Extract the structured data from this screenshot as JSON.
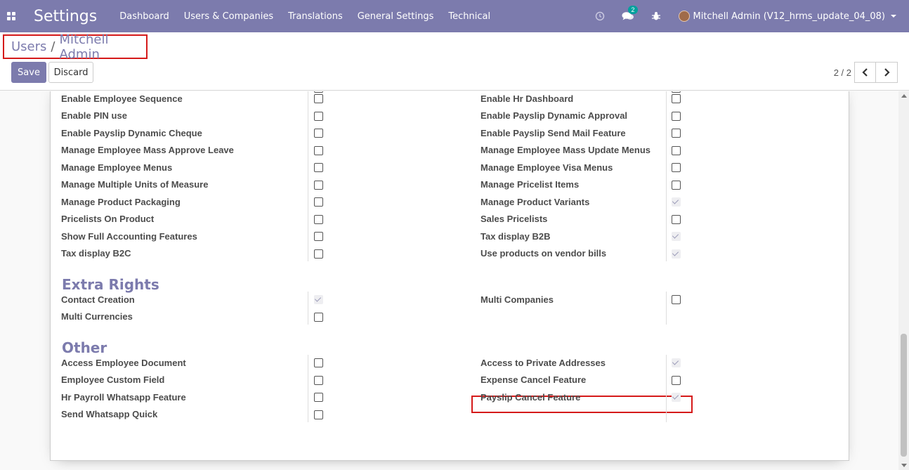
{
  "navbar": {
    "title": "Settings",
    "menu": [
      "Dashboard",
      "Users & Companies",
      "Translations",
      "General Settings",
      "Technical"
    ],
    "chat_count": "2",
    "user_label": "Mitchell Admin (V12_hrms_update_04_08)"
  },
  "breadcrumb": {
    "parent": "Users",
    "separator": "/",
    "current": "Mitchell Admin"
  },
  "buttons": {
    "save": "Save",
    "discard": "Discard"
  },
  "pager": {
    "value": "2 / 2"
  },
  "left_rows": [
    {
      "label": "Enable Employee Sequence",
      "checked": false
    },
    {
      "label": "Enable PIN use",
      "checked": false
    },
    {
      "label": "Enable Payslip Dynamic Cheque",
      "checked": false
    },
    {
      "label": "Manage Employee Mass Approve Leave",
      "checked": false
    },
    {
      "label": "Manage Employee Menus",
      "checked": false
    },
    {
      "label": "Manage Multiple Units of Measure",
      "checked": false
    },
    {
      "label": "Manage Product Packaging",
      "checked": false
    },
    {
      "label": "Pricelists On Product",
      "checked": false
    },
    {
      "label": "Show Full Accounting Features",
      "checked": false
    },
    {
      "label": "Tax display B2C",
      "checked": false
    }
  ],
  "right_rows": [
    {
      "label": "Enable Hr Dashboard",
      "checked": false
    },
    {
      "label": "Enable Payslip Dynamic Approval",
      "checked": false
    },
    {
      "label": "Enable Payslip Send Mail Feature",
      "checked": false
    },
    {
      "label": "Manage Employee Mass Update Menus",
      "checked": false
    },
    {
      "label": "Manage Employee Visa Menus",
      "checked": false
    },
    {
      "label": "Manage Pricelist Items",
      "checked": false
    },
    {
      "label": "Manage Product Variants",
      "checked": true
    },
    {
      "label": "Sales Pricelists",
      "checked": false
    },
    {
      "label": "Tax display B2B",
      "checked": true
    },
    {
      "label": "Use products on vendor bills",
      "checked": true
    }
  ],
  "extra_rights": {
    "title": "Extra Rights",
    "left": [
      {
        "label": "Contact Creation",
        "checked": true
      },
      {
        "label": "Multi Currencies",
        "checked": false
      }
    ],
    "right": [
      {
        "label": "Multi Companies",
        "checked": false
      }
    ]
  },
  "other": {
    "title": "Other",
    "left": [
      {
        "label": "Access Employee Document",
        "checked": false
      },
      {
        "label": "Employee Custom Field",
        "checked": false
      },
      {
        "label": "Hr Payroll Whatsapp Feature",
        "checked": false
      },
      {
        "label": "Send Whatsapp Quick",
        "checked": false
      }
    ],
    "right": [
      {
        "label": "Access to Private Addresses",
        "checked": true
      },
      {
        "label": "Expense Cancel Feature",
        "checked": false
      },
      {
        "label": "Payslip Cancel Feature",
        "checked": true
      }
    ]
  },
  "colors": {
    "primary": "#7c7bad",
    "highlight": "#d51a1a"
  }
}
